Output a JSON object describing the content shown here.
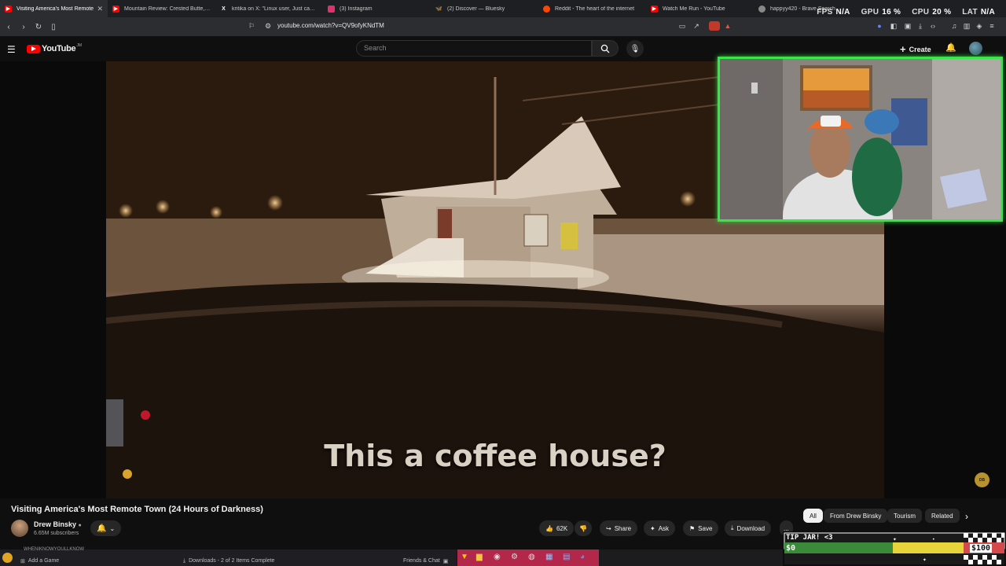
{
  "tabs": [
    {
      "label": "Visiting America's Most Remote",
      "icon": "youtube-icon",
      "color": "#ff0000",
      "active": true
    },
    {
      "label": "Mountain Review: Crested Butte, Co",
      "icon": "youtube-icon",
      "color": "#ff0000"
    },
    {
      "label": "kritika on X: \"Linux user, Just came a",
      "icon": "x-icon",
      "color": "#ffffff"
    },
    {
      "label": "(3) Instagram",
      "icon": "instagram-icon",
      "color": "#e1306c"
    },
    {
      "label": "(2) Discover — Bluesky",
      "icon": "bluesky-icon",
      "color": "#1185fe"
    },
    {
      "label": "Reddit - The heart of the internet",
      "icon": "reddit-icon",
      "color": "#ff4500"
    },
    {
      "label": "Watch Me Run - YouTube",
      "icon": "youtube-icon",
      "color": "#ff0000"
    },
    {
      "label": "happyy420 - Brave Search",
      "icon": "brave-icon",
      "color": "#fb542b"
    }
  ],
  "stats": {
    "fps_label": "FPS",
    "fps_value": "N/A",
    "gpu_label": "GPU",
    "gpu_value": "16 %",
    "cpu_label": "CPU",
    "cpu_value": "20 %",
    "lat_label": "LAT",
    "lat_value": "N/A"
  },
  "address": {
    "url": "youtube.com/watch?v=QV9ofyKNdTM"
  },
  "youtube": {
    "logo": "YouTube",
    "logo_sup": "JM",
    "search_placeholder": "Search",
    "create_label": "Create"
  },
  "video": {
    "caption": "This a coffee house?",
    "title": "Visiting America's Most Remote Town (24 Hours of Darkness)",
    "channel": "Drew Binsky",
    "subscribers": "6.65M subscribers",
    "likes": "62K",
    "share_label": "Share",
    "ask_label": "Ask",
    "save_label": "Save",
    "download_label": "Download",
    "more_label": "..."
  },
  "chips": [
    "All",
    "From Drew Binsky",
    "Tourism",
    "Related"
  ],
  "taskbar": {
    "add_game": "Add a Game",
    "downloads": "Downloads - 2 of 2 Items Complete",
    "friends": "Friends & Chat",
    "whenever": "WHENIKNOWYOULLKNOW"
  },
  "tipjar": {
    "label": "TIP JAR! <3",
    "current": "$0",
    "goal": "$100"
  },
  "colors": {
    "accent_green": "#39e64a",
    "youtube_red": "#ff0000"
  }
}
